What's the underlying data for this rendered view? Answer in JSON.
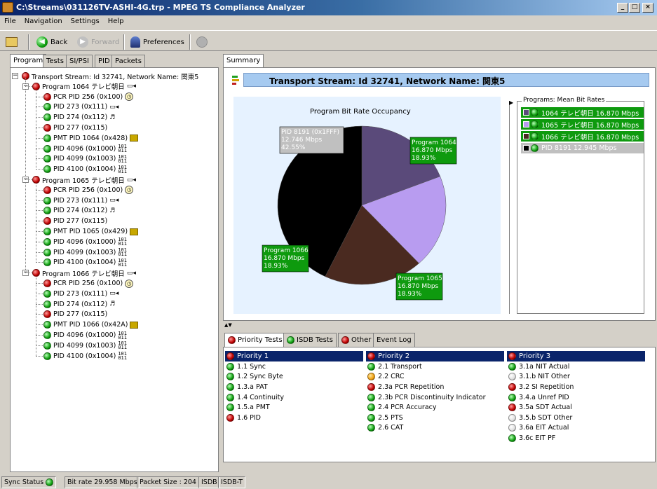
{
  "window": {
    "title": "C:\\Streams\\031126TV-ASHI-4G.trp - MPEG TS Compliance Analyzer",
    "minimize": "_",
    "maximize": "□",
    "close": "×"
  },
  "menu": [
    "File",
    "Navigation",
    "Settings",
    "Help"
  ],
  "toolbar": {
    "back": "Back",
    "forward": "Forward",
    "preferences": "Preferences"
  },
  "left_tabs": [
    "Program",
    "Tests",
    "SI/PSI",
    "PID",
    "Packets"
  ],
  "tree": {
    "root": "Transport Stream: Id 32741, Network Name: 関東5",
    "programs": [
      {
        "label": "Program 1064 テレビ朝日",
        "children": [
          {
            "label": "PCR PID 256 (0x100)",
            "status": "red",
            "icon": "clock-icon"
          },
          {
            "label": "PID 273 (0x111)",
            "status": "green",
            "icon": "video-icon"
          },
          {
            "label": "PID 274 (0x112)",
            "status": "green",
            "icon": "music-icon"
          },
          {
            "label": "PID 277 (0x115)",
            "status": "red",
            "icon": ""
          },
          {
            "label": "PMT PID 1064 (0x428)",
            "status": "green",
            "icon": "table-icon"
          },
          {
            "label": "PID 4096 (0x1000)",
            "status": "green",
            "icon": "binary-icon"
          },
          {
            "label": "PID 4099 (0x1003)",
            "status": "green",
            "icon": "binary-icon"
          },
          {
            "label": "PID 4100 (0x1004)",
            "status": "green",
            "icon": "binary-icon"
          }
        ]
      },
      {
        "label": "Program 1065 テレビ朝日",
        "children": [
          {
            "label": "PCR PID 256 (0x100)",
            "status": "red",
            "icon": "clock-icon"
          },
          {
            "label": "PID 273 (0x111)",
            "status": "green",
            "icon": "video-icon"
          },
          {
            "label": "PID 274 (0x112)",
            "status": "green",
            "icon": "music-icon"
          },
          {
            "label": "PID 277 (0x115)",
            "status": "red",
            "icon": ""
          },
          {
            "label": "PMT PID 1065 (0x429)",
            "status": "green",
            "icon": "table-icon"
          },
          {
            "label": "PID 4096 (0x1000)",
            "status": "green",
            "icon": "binary-icon"
          },
          {
            "label": "PID 4099 (0x1003)",
            "status": "green",
            "icon": "binary-icon"
          },
          {
            "label": "PID 4100 (0x1004)",
            "status": "green",
            "icon": "binary-icon"
          }
        ]
      },
      {
        "label": "Program 1066 テレビ朝日",
        "children": [
          {
            "label": "PCR PID 256 (0x100)",
            "status": "red",
            "icon": "clock-icon"
          },
          {
            "label": "PID 273 (0x111)",
            "status": "green",
            "icon": "video-icon"
          },
          {
            "label": "PID 274 (0x112)",
            "status": "green",
            "icon": "music-icon"
          },
          {
            "label": "PID 277 (0x115)",
            "status": "red",
            "icon": ""
          },
          {
            "label": "PMT PID 1066 (0x42A)",
            "status": "green",
            "icon": "table-icon"
          },
          {
            "label": "PID 4096 (0x1000)",
            "status": "green",
            "icon": "binary-icon"
          },
          {
            "label": "PID 4099 (0x1003)",
            "status": "green",
            "icon": "binary-icon"
          },
          {
            "label": "PID 4100 (0x1004)",
            "status": "green",
            "icon": "binary-icon"
          }
        ]
      }
    ]
  },
  "summary": {
    "tab": "Summary",
    "header": "Transport Stream: Id 32741, Network Name: 関東5",
    "legend_title": "Programs: Mean Bit Rates",
    "legend": [
      {
        "label": "1064 テレビ朝日 16.870 Mbps",
        "swatch": "#5a4a7a",
        "row_bg": "#0e9a0e"
      },
      {
        "label": "1065 テレビ朝日 16.870 Mbps",
        "swatch": "#b89cf0",
        "row_bg": "#0e9a0e"
      },
      {
        "label": "1066 テレビ朝日 16.870 Mbps",
        "swatch": "#4a2a20",
        "row_bg": "#0e9a0e"
      },
      {
        "label": "PID 8191 12.945 Mbps",
        "swatch": "#000000",
        "row_bg": "#c0c0c0"
      }
    ]
  },
  "chart_data": {
    "type": "pie",
    "title": "Program Bit Rate Occupancy",
    "slices": [
      {
        "name": "Program 1064",
        "lines": [
          "Program 1064",
          "16.870 Mbps",
          "18.93%"
        ],
        "value": 18.93,
        "color": "#5a4a7a",
        "label_bg": "#0e9a0e"
      },
      {
        "name": "Program 1065",
        "lines": [
          "Program 1065",
          "16.870 Mbps",
          "18.93%"
        ],
        "value": 18.93,
        "color": "#b89cf0",
        "label_bg": "#0e9a0e"
      },
      {
        "name": "Program 1066",
        "lines": [
          "Program 1066",
          "16.870 Mbps",
          "18.93%"
        ],
        "value": 18.93,
        "color": "#4a2a20",
        "label_bg": "#0e9a0e"
      },
      {
        "name": "PID 8191",
        "lines": [
          "PID 8191  (0x1FFF)",
          "12.746  Mbps",
          "42.55%"
        ],
        "value": 42.55,
        "color": "#000000",
        "label_bg": "#c0c0c0"
      }
    ]
  },
  "bottom_tabs": [
    {
      "label": "Priority Tests",
      "status": "red"
    },
    {
      "label": "ISDB Tests",
      "status": "green"
    },
    {
      "label": "Other",
      "status": "red"
    },
    {
      "label": "Event Log",
      "status": ""
    }
  ],
  "tests": [
    {
      "header": "Priority 1",
      "status": "red",
      "items": [
        {
          "label": "1.1 Sync",
          "status": "green"
        },
        {
          "label": "1.2 Sync Byte",
          "status": "green"
        },
        {
          "label": "1.3.a PAT",
          "status": "green"
        },
        {
          "label": "1.4 Continuity",
          "status": "green"
        },
        {
          "label": "1.5.a PMT",
          "status": "green"
        },
        {
          "label": "1.6 PID",
          "status": "red"
        }
      ]
    },
    {
      "header": "Priority 2",
      "status": "red",
      "items": [
        {
          "label": "2.1 Transport",
          "status": "green"
        },
        {
          "label": "2.2 CRC",
          "status": "orange"
        },
        {
          "label": "2.3a PCR Repetition",
          "status": "red"
        },
        {
          "label": "2.3b PCR Discontinuity Indicator",
          "status": "green"
        },
        {
          "label": "2.4 PCR Accuracy",
          "status": "green"
        },
        {
          "label": "2.5 PTS",
          "status": "green"
        },
        {
          "label": "2.6 CAT",
          "status": "green"
        }
      ]
    },
    {
      "header": "Priority 3",
      "status": "red",
      "items": [
        {
          "label": "3.1a NIT Actual",
          "status": "green"
        },
        {
          "label": "3.1.b NIT Other",
          "status": "white"
        },
        {
          "label": "3.2 SI Repetition",
          "status": "red"
        },
        {
          "label": "3.4.a Unref PID",
          "status": "green"
        },
        {
          "label": "3.5a SDT Actual",
          "status": "red"
        },
        {
          "label": "3.5.b SDT Other",
          "status": "white"
        },
        {
          "label": "3.6a EIT Actual",
          "status": "white"
        },
        {
          "label": "3.6c EIT PF",
          "status": "green"
        }
      ]
    }
  ],
  "status": {
    "sync": "Sync Status",
    "bitrate": "Bit rate  29.958 Mbps",
    "packet": "Packet Size : 204",
    "isdb": "ISDB",
    "isdbt": "ISDB-T"
  }
}
